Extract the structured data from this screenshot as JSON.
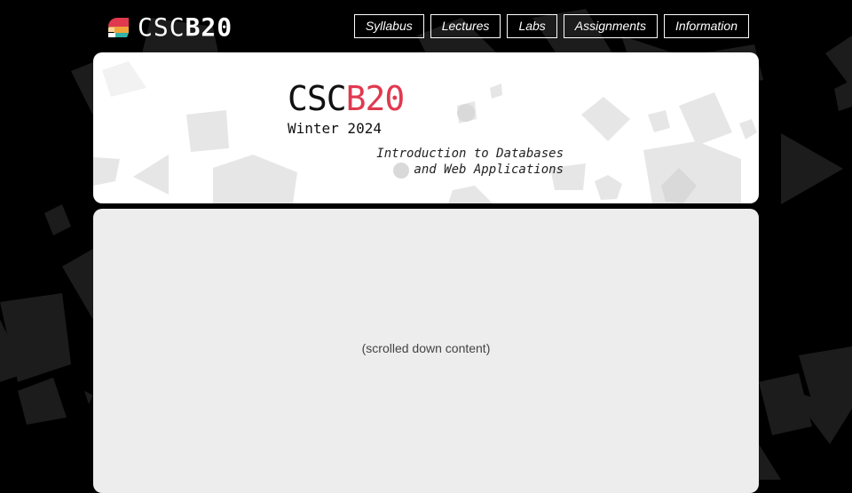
{
  "brand": {
    "logo_prefix": "CSC",
    "logo_suffix": "B20",
    "accent_color": "#e0394f"
  },
  "nav": {
    "items": [
      {
        "label": "Syllabus"
      },
      {
        "label": "Lectures"
      },
      {
        "label": "Labs"
      },
      {
        "label": "Assignments"
      },
      {
        "label": "Information"
      }
    ]
  },
  "hero": {
    "title_prefix": "CSC",
    "title_suffix": "B20",
    "term": "Winter 2024",
    "subtitle_line1": "Introduction to Databases",
    "subtitle_line2": "and Web Applications"
  },
  "content": {
    "placeholder": "(scrolled down content)"
  }
}
